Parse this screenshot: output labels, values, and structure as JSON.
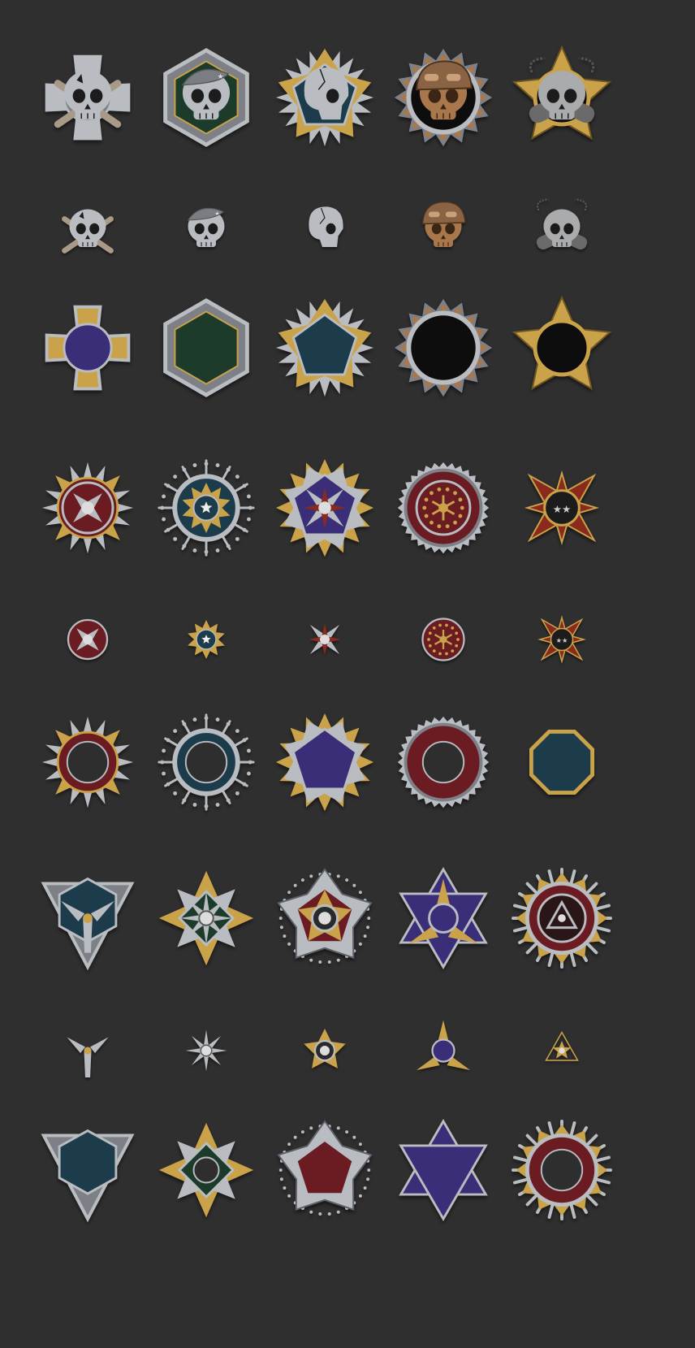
{
  "sheet": {
    "title": "",
    "background": "#2f2f2f"
  },
  "palette": {
    "silver": "#b9bcc0",
    "steel": "#7d8187",
    "gold": "#c9a24a",
    "bronze": "#a8774b",
    "navy": "#1e3a4c",
    "purple": "#3a2f78",
    "green": "#1e3b2c",
    "maroon": "#6b1f22",
    "black": "#100c08",
    "red": "#8a2c1a"
  },
  "groups": [
    {
      "name": "skull-medals",
      "rows": [
        {
          "kind": "full",
          "items": [
            {
              "name": "iron-cross-skull-medal",
              "shape": "cross",
              "emblem": "skull-crossbones",
              "frame": "silver",
              "fill": "steel"
            },
            {
              "name": "beret-skull-hexagon-medal",
              "shape": "hexagon",
              "emblem": "skull-beret",
              "frame": "silver",
              "fill": "green"
            },
            {
              "name": "cracked-skull-spiked-pentagon-medal",
              "shape": "spiked-pentagon",
              "emblem": "skull-side",
              "frame": "gold",
              "fill": "navy"
            },
            {
              "name": "helmet-skull-gear-medal",
              "shape": "gear-ring",
              "emblem": "skull-helmet",
              "frame": "bronze",
              "fill": "black"
            },
            {
              "name": "dogtag-skull-star-medal",
              "shape": "star",
              "emblem": "skull-dogtags",
              "frame": "gold",
              "fill": "black"
            }
          ]
        },
        {
          "kind": "emblem",
          "items": [
            {
              "name": "skull-crossbones-emblem",
              "emblem": "skull-crossbones"
            },
            {
              "name": "skull-beret-emblem",
              "emblem": "skull-beret"
            },
            {
              "name": "skull-side-emblem",
              "emblem": "skull-side"
            },
            {
              "name": "skull-helmet-emblem",
              "emblem": "skull-helmet"
            },
            {
              "name": "skull-dogtags-emblem",
              "emblem": "skull-dogtags"
            }
          ]
        },
        {
          "kind": "base",
          "items": [
            {
              "name": "iron-cross-base",
              "shape": "cross",
              "frame": "gold",
              "fill": "purple"
            },
            {
              "name": "hexagon-base",
              "shape": "hexagon",
              "frame": "silver",
              "fill": "green"
            },
            {
              "name": "spiked-pentagon-base",
              "shape": "spiked-pentagon",
              "frame": "gold",
              "fill": "navy"
            },
            {
              "name": "gear-ring-base",
              "shape": "gear-ring",
              "frame": "bronze",
              "fill": "black"
            },
            {
              "name": "star-base",
              "shape": "star",
              "frame": "gold",
              "fill": "black"
            }
          ]
        }
      ]
    },
    {
      "name": "order-medals",
      "rows": [
        {
          "kind": "full",
          "items": [
            {
              "name": "maltese-order-medal",
              "shape": "maltese-star",
              "emblem": "cross-disc",
              "frame": "gold",
              "fill": "maroon"
            },
            {
              "name": "starburst-order-medal",
              "shape": "starburst",
              "emblem": "star-disc",
              "frame": "silver",
              "fill": "navy"
            },
            {
              "name": "pentagon-sunburst-medal",
              "shape": "sunburst",
              "emblem": "x-rays",
              "frame": "gold",
              "fill": "purple"
            },
            {
              "name": "laurel-ring-medal",
              "shape": "serrated-ring",
              "emblem": "laurel-disc",
              "frame": "silver",
              "fill": "maroon"
            },
            {
              "name": "red-cross-stars-medal",
              "shape": "red-cross",
              "emblem": "stars-disc",
              "frame": "gold",
              "fill": "red"
            }
          ]
        },
        {
          "kind": "emblem",
          "items": [
            {
              "name": "cross-disc-emblem",
              "emblem": "cross-disc"
            },
            {
              "name": "star-disc-emblem",
              "emblem": "star-disc"
            },
            {
              "name": "x-rays-emblem",
              "emblem": "x-rays"
            },
            {
              "name": "laurel-disc-emblem",
              "emblem": "laurel-disc"
            },
            {
              "name": "red-cross-stars-emblem",
              "emblem": "red-cross-stars"
            }
          ]
        },
        {
          "kind": "base",
          "items": [
            {
              "name": "maltese-ring-base",
              "shape": "maltese-star",
              "frame": "gold",
              "fill": "maroon",
              "hole": true
            },
            {
              "name": "starburst-ring-base",
              "shape": "starburst",
              "frame": "silver",
              "fill": "navy",
              "hole": true
            },
            {
              "name": "pentagon-sunburst-base",
              "shape": "sunburst",
              "frame": "gold",
              "fill": "purple"
            },
            {
              "name": "serrated-ring-base",
              "shape": "serrated-ring",
              "frame": "silver",
              "fill": "maroon",
              "hole": true
            },
            {
              "name": "octagon-base",
              "shape": "octagon",
              "frame": "gold",
              "fill": "navy"
            }
          ]
        }
      ]
    },
    {
      "name": "geometric-medals",
      "rows": [
        {
          "kind": "full",
          "items": [
            {
              "name": "inverted-triangle-medal",
              "shape": "inv-triangle",
              "emblem": "tri-wings",
              "frame": "silver",
              "fill": "navy"
            },
            {
              "name": "diamond-cross-medal",
              "shape": "diamond-cross",
              "emblem": "petal-cross",
              "frame": "gold",
              "fill": "green"
            },
            {
              "name": "star-pentagon-medal",
              "shape": "star-pentagon",
              "emblem": "star-core",
              "frame": "silver",
              "fill": "maroon"
            },
            {
              "name": "hexagram-medal",
              "shape": "hexagram",
              "emblem": "tri-blades",
              "frame": "silver",
              "fill": "purple"
            },
            {
              "name": "sunburst-ring-medal",
              "shape": "sunburst-ring",
              "emblem": "triangle-disc",
              "frame": "gold",
              "fill": "maroon"
            }
          ]
        },
        {
          "kind": "emblem",
          "items": [
            {
              "name": "tri-wings-emblem",
              "emblem": "tri-wings"
            },
            {
              "name": "petal-cross-emblem",
              "emblem": "petal-cross"
            },
            {
              "name": "star-core-emblem",
              "emblem": "star-core"
            },
            {
              "name": "tri-blades-emblem",
              "emblem": "tri-blades"
            },
            {
              "name": "triangle-star-emblem",
              "emblem": "triangle-star"
            }
          ]
        },
        {
          "kind": "base",
          "items": [
            {
              "name": "inverted-triangle-base",
              "shape": "inv-triangle",
              "frame": "silver",
              "fill": "navy"
            },
            {
              "name": "diamond-cross-base",
              "shape": "diamond-cross",
              "frame": "gold",
              "fill": "green",
              "hole": true
            },
            {
              "name": "star-pentagon-base",
              "shape": "star-pentagon",
              "frame": "silver",
              "fill": "maroon"
            },
            {
              "name": "hexagram-base",
              "shape": "hexagram",
              "frame": "silver",
              "fill": "purple"
            },
            {
              "name": "sunburst-ring-base",
              "shape": "sunburst-ring",
              "frame": "gold",
              "fill": "maroon",
              "hole": true
            }
          ]
        }
      ]
    }
  ]
}
